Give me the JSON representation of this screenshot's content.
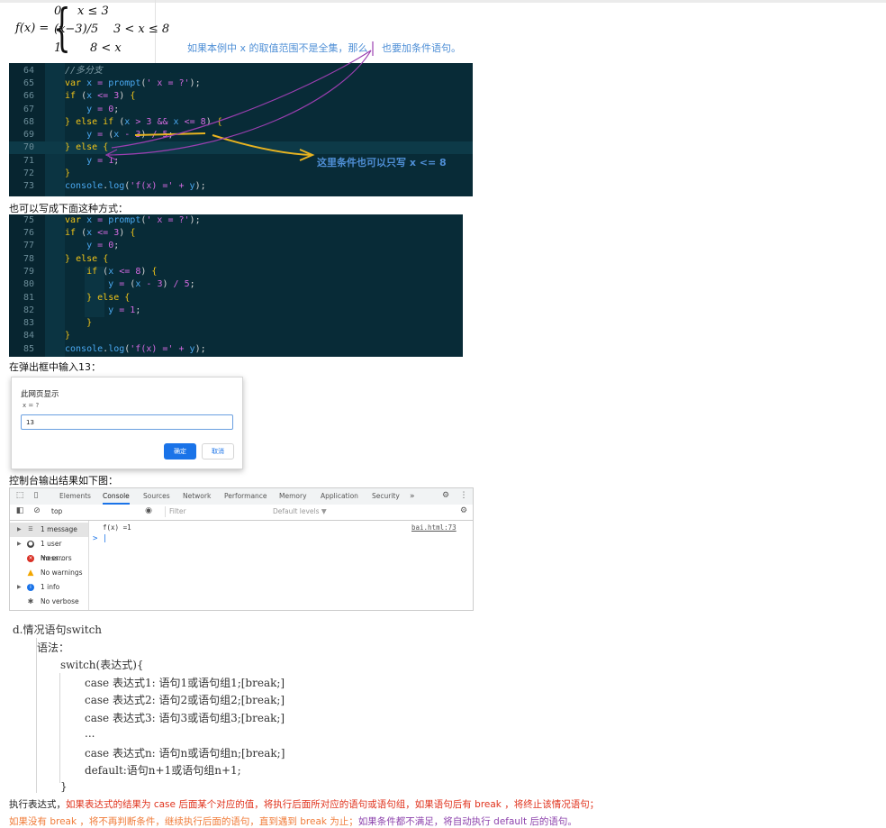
{
  "formula": {
    "lhs": "f(x) =",
    "cases": [
      {
        "value": "0",
        "condition": "x ≤ 3"
      },
      {
        "value": "(x−3)/5",
        "condition": "3 < x ≤ 8"
      },
      {
        "value": "1",
        "condition": "8 < x"
      }
    ]
  },
  "note_domain": "如果本例中 x 的取值范围不是全集，那么",
  "note_domain_2": "也要加条件语句。",
  "code_block_1": {
    "lines": [
      {
        "no": "64",
        "text": "//多分支"
      },
      {
        "no": "65",
        "text": "var x = prompt(' x = ?');"
      },
      {
        "no": "66",
        "text": "if (x <= 3) {"
      },
      {
        "no": "67",
        "text": "    y = 0;"
      },
      {
        "no": "68",
        "text": "} else if (x > 3 && x <= 8) {"
      },
      {
        "no": "69",
        "text": "    y = (x - 3) / 5;"
      },
      {
        "no": "70",
        "text": "} else {"
      },
      {
        "no": "71",
        "text": "    y = 1;"
      },
      {
        "no": "72",
        "text": "}"
      },
      {
        "no": "73",
        "text": "console.log('f(x) =' + y);"
      }
    ],
    "annotation": "这里条件也可以只写 x <= 8"
  },
  "caption_alt": "也可以写成下面这种方式：",
  "code_block_2": {
    "lines": [
      {
        "no": "75",
        "text": "var x = prompt(' x = ?');"
      },
      {
        "no": "76",
        "text": "if (x <= 3) {"
      },
      {
        "no": "77",
        "text": "    y = 0;"
      },
      {
        "no": "78",
        "text": "} else {"
      },
      {
        "no": "79",
        "text": "    if (x <= 8) {"
      },
      {
        "no": "80",
        "text": "        y = (x - 3) / 5;"
      },
      {
        "no": "81",
        "text": "    } else {"
      },
      {
        "no": "82",
        "text": "        y = 1;"
      },
      {
        "no": "83",
        "text": "    }"
      },
      {
        "no": "84",
        "text": "}"
      },
      {
        "no": "85",
        "text": "console.log('f(x) =' + y);"
      }
    ]
  },
  "caption_input": "在弹出框中输入13：",
  "dialog": {
    "title": "此网页显示",
    "message": "x = ?",
    "input_value": "13",
    "ok_label": "确定",
    "cancel_label": "取消"
  },
  "caption_console": "控制台输出结果如下图：",
  "devtools": {
    "tabs": [
      "Elements",
      "Console",
      "Sources",
      "Network",
      "Performance",
      "Memory",
      "Application",
      "Security"
    ],
    "active_tab": "Console",
    "more_tabs": "»",
    "context": "top",
    "filter_placeholder": "Filter",
    "levels": "Default levels ▼",
    "sidebar": [
      {
        "label": "1 message",
        "icon": "list-icon"
      },
      {
        "label": "1 user mess…",
        "icon": "user-icon"
      },
      {
        "label": "No errors",
        "icon": "error-icon"
      },
      {
        "label": "No warnings",
        "icon": "warning-icon"
      },
      {
        "label": "1 info",
        "icon": "info-icon"
      },
      {
        "label": "No verbose",
        "icon": "verbose-icon"
      }
    ],
    "log_text": "f(x) =1",
    "log_source": "bai.html:73",
    "prompt_symbol": "> |"
  },
  "switch_section": {
    "heading": "d.情况语句switch",
    "syntax_label": "语法：",
    "lines": [
      "switch(表达式){",
      "case 表达式1: 语句1或语句组1;[break;]",
      "case 表达式2: 语句2或语句组2;[break;]",
      "case 表达式3: 语句3或语句组3;[break;]",
      "...",
      "case 表达式n: 语句n或语句组n;[break;]",
      "default:语句n+1或语句组n+1;",
      "}"
    ]
  },
  "explanation": {
    "line1_prefix": "执行表达式，",
    "line1_red": "如果表达式的结果为 case 后面某个对应的值，将执行后面所对应的语句或语句组，如果语句后有 break ，将终止该情况语句；",
    "line2_orange": "如果没有 break ，将不再判断条件，继续执行后面的语句，直到遇到 break 为止；",
    "line2_purple": "如果条件都不满足，将自动执行 default 后的语句。"
  },
  "colors": {
    "code_bg": "#082b37",
    "keyword": "#f0c419",
    "string": "#d36ae0",
    "variable": "#4aa8f0",
    "note_blue": "#4f8fd6",
    "red_text": "#e0321c",
    "orange_text": "#f07c3a",
    "purple_text": "#8e44ad"
  }
}
